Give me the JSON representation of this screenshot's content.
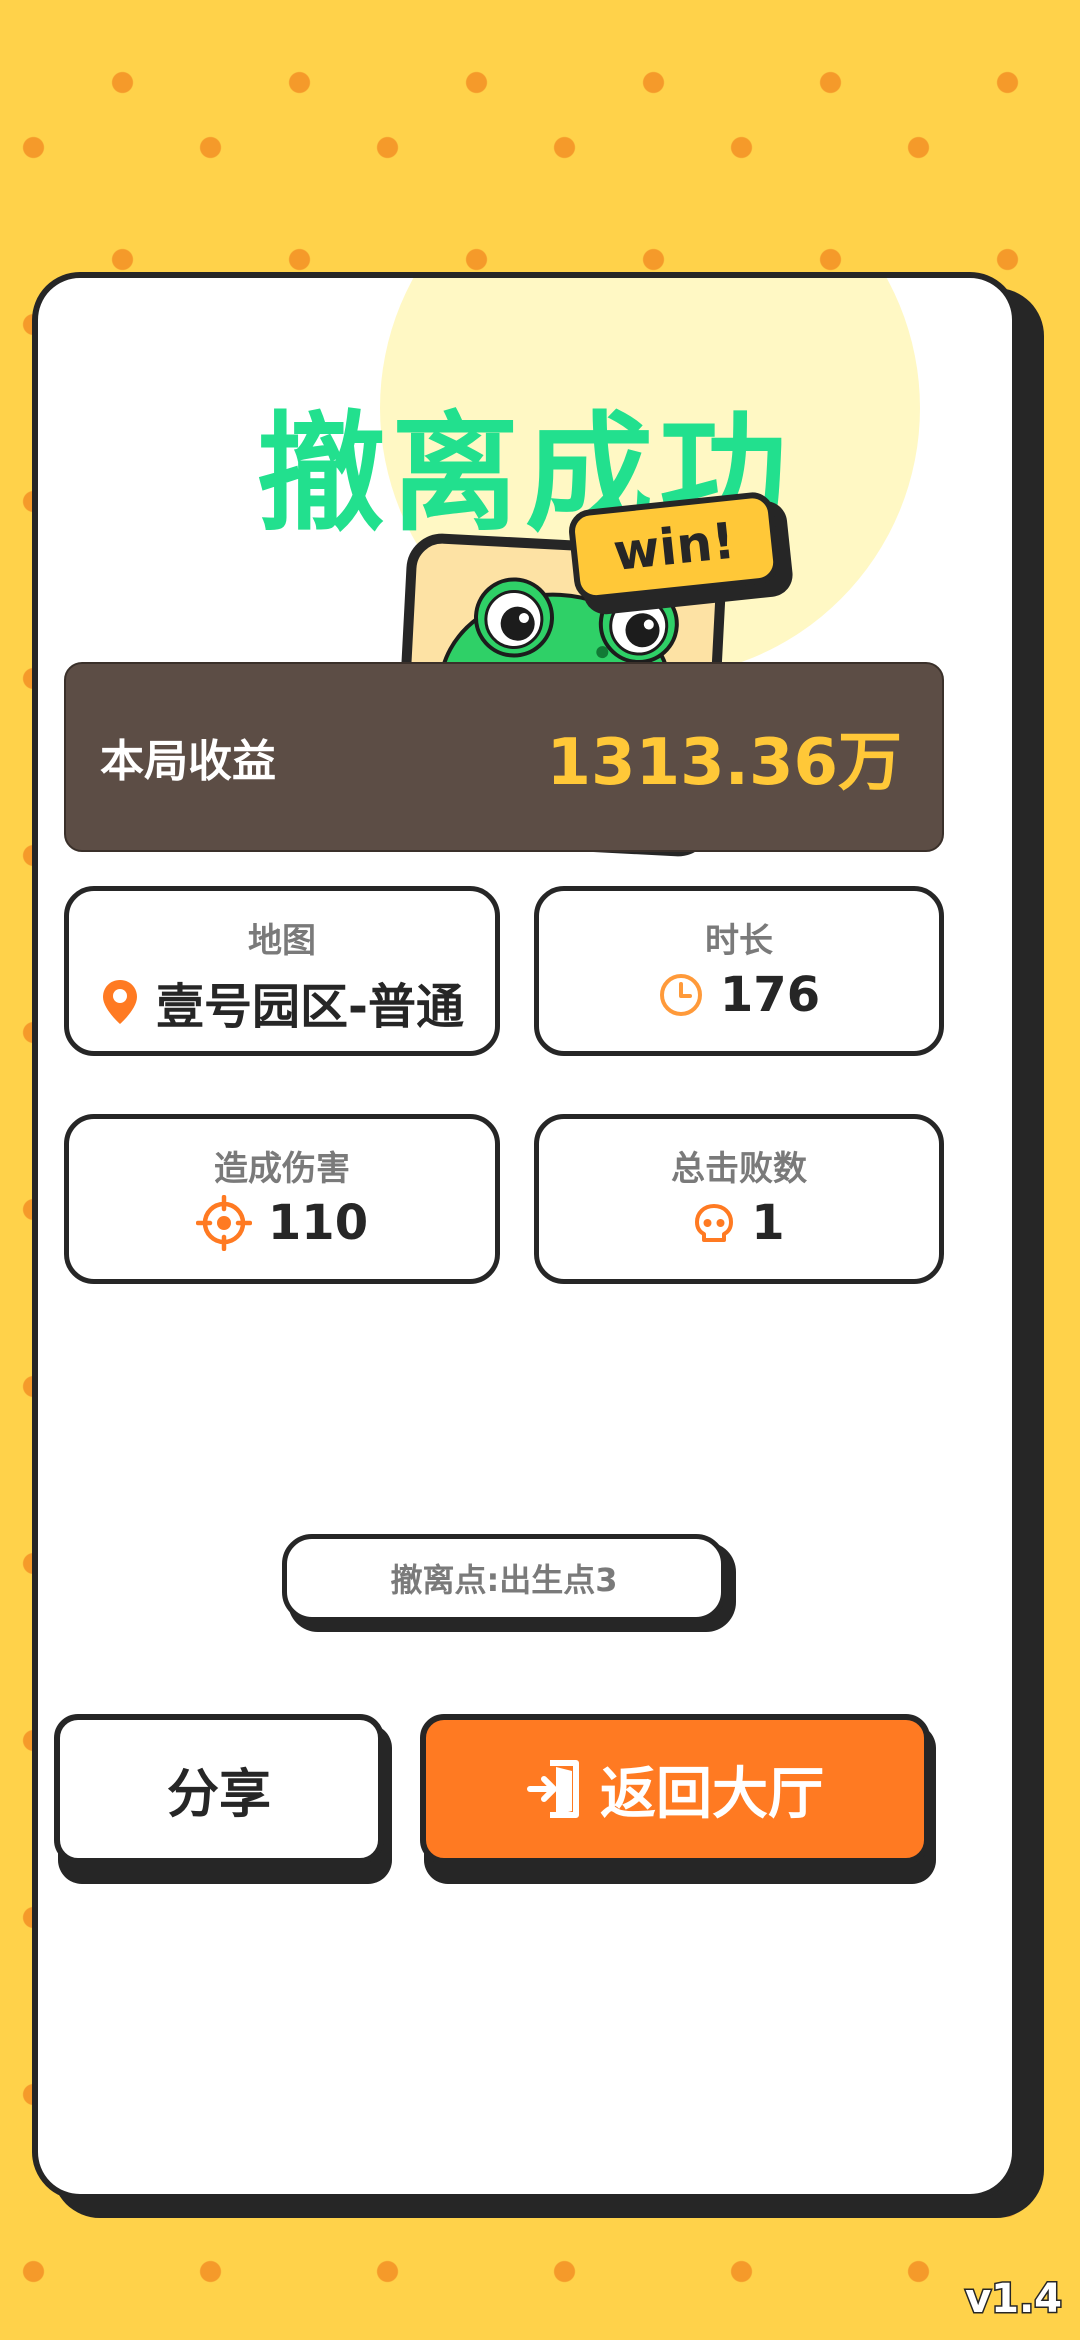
{
  "title": "撤离成功",
  "badge": "win!",
  "earnings": {
    "label": "本局收益",
    "value": "1313.36万"
  },
  "stats": {
    "map": {
      "label": "地图",
      "value": "壹号园区-普通",
      "icon": "location-pin-icon"
    },
    "duration": {
      "label": "时长",
      "value": "176",
      "icon": "clock-icon"
    },
    "damage": {
      "label": "造成伤害",
      "value": "110",
      "icon": "crosshair-icon"
    },
    "kills": {
      "label": "总击败数",
      "value": "1",
      "icon": "skull-icon"
    }
  },
  "extraction_point": "撤离点:出生点3",
  "buttons": {
    "share": "分享",
    "back_to_lobby": "返回大厅"
  },
  "version": "v1.4",
  "colors": {
    "background": "#ffd24a",
    "title": "#22e08e",
    "earnings_bg": "#5c4d45",
    "earnings_value": "#ffc838",
    "accent": "#ff7a22",
    "outline": "#262626"
  }
}
